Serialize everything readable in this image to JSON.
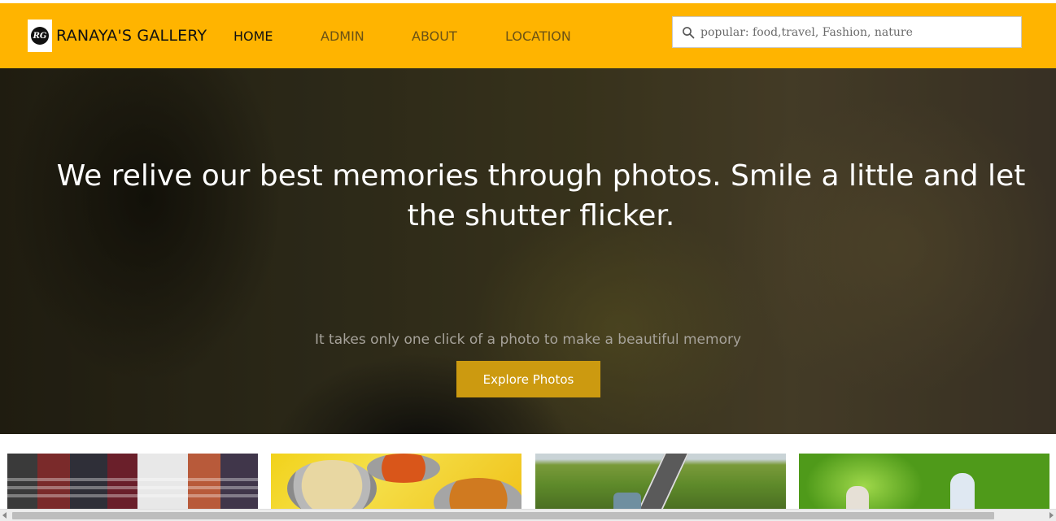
{
  "brand": {
    "logo_text": "RG",
    "name": "RANAYA'S GALLERY"
  },
  "nav": {
    "items": [
      {
        "label": "HOME",
        "active": true
      },
      {
        "label": "ADMIN",
        "active": false
      },
      {
        "label": "ABOUT",
        "active": false
      },
      {
        "label": "LOCATION",
        "active": false
      }
    ]
  },
  "search": {
    "placeholder": "popular: food,travel, Fashion, nature",
    "value": "",
    "icon": "search-icon"
  },
  "hero": {
    "headline": "We relive our best memories through photos. Smile a little and let the shutter flicker.",
    "subtitle": "It takes only one click of a photo to make a beautiful memory",
    "cta_label": "Explore Photos"
  },
  "colors": {
    "navbar": "#ffb400",
    "cta": "#cc9a10",
    "nav_active": "#111111",
    "nav_inactive": "#6b5215"
  }
}
